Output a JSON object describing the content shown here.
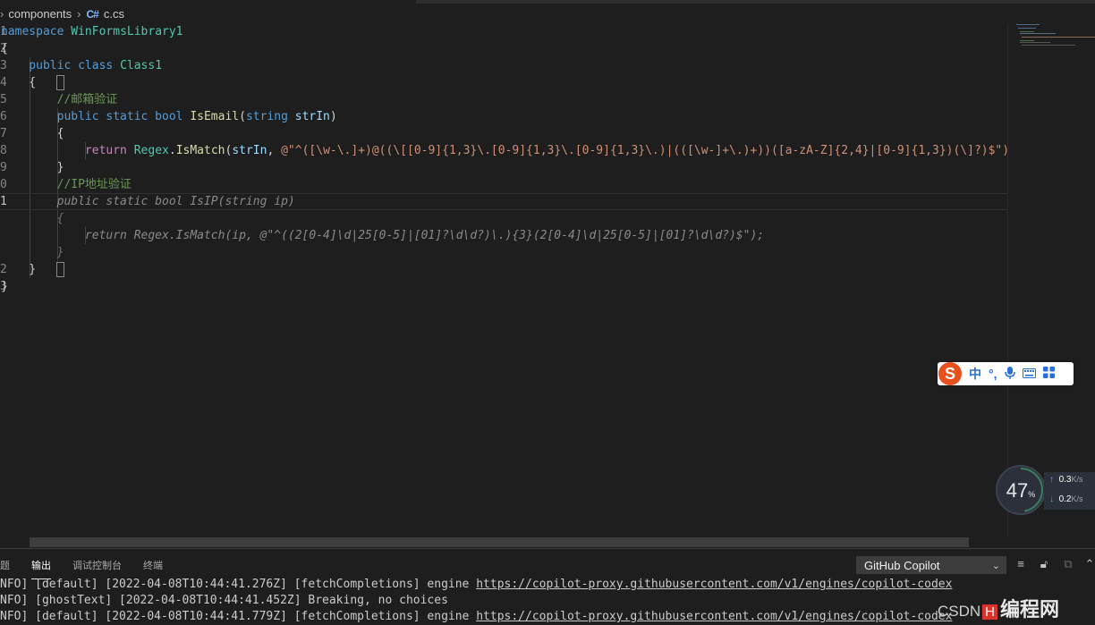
{
  "breadcrumb": {
    "folder": "components",
    "file_icon": "C#",
    "file": "c.cs"
  },
  "editor": {
    "lines": [
      {
        "num": "1",
        "tokens": [
          [
            "namespace ",
            "#569cd6"
          ],
          [
            "WinFormsLibrary1",
            "#4ec9b0"
          ]
        ]
      },
      {
        "num": "2",
        "tokens": [
          [
            "{",
            "#d4d4d4"
          ]
        ]
      },
      {
        "num": "3",
        "tokens": [
          [
            "    public ",
            "#569cd6"
          ],
          [
            "class ",
            "#569cd6"
          ],
          [
            "Class1",
            "#4ec9b0"
          ]
        ]
      },
      {
        "num": "4",
        "tokens": [
          [
            "    {",
            "#d4d4d4"
          ]
        ]
      },
      {
        "num": "5",
        "tokens": [
          [
            "        //邮箱验证",
            "#6a9955"
          ]
        ]
      },
      {
        "num": "6",
        "tokens": [
          [
            "        public static bool ",
            "#569cd6"
          ],
          [
            "IsEmail",
            "#dcdcaa"
          ],
          [
            "(",
            "#d4d4d4"
          ],
          [
            "string ",
            "#569cd6"
          ],
          [
            "strIn",
            "#9cdcfe"
          ],
          [
            ")",
            "#d4d4d4"
          ]
        ]
      },
      {
        "num": "7",
        "tokens": [
          [
            "        {",
            "#d4d4d4"
          ]
        ]
      },
      {
        "num": "8",
        "tokens": [
          [
            "            return ",
            "#c586c0"
          ],
          [
            "Regex",
            "#4ec9b0"
          ],
          [
            ".",
            "#d4d4d4"
          ],
          [
            "IsMatch",
            "#dcdcaa"
          ],
          [
            "(",
            "#d4d4d4"
          ],
          [
            "strIn",
            "#9cdcfe"
          ],
          [
            ", ",
            "#d4d4d4"
          ],
          [
            "@\"^([\\w-\\.]+)@((\\[[0-9]{1,3}\\.[0-9]{1,3}\\.[0-9]{1,3}\\.)|(([\\w-]+\\.)+))([a-zA-Z]{2,4}|[0-9]{1,3})(\\]?)$\");",
            "#ce9178"
          ]
        ]
      },
      {
        "num": "9",
        "tokens": [
          [
            "        }",
            "#d4d4d4"
          ]
        ]
      },
      {
        "num": "0",
        "tokens": [
          [
            "        //IP地址验证",
            "#6a9955"
          ]
        ]
      },
      {
        "num": "1",
        "current": true,
        "tokens": [
          [
            "        public static bool IsIP(string ip)",
            "#8a8a8a",
            "italic"
          ]
        ]
      },
      {
        "num": "",
        "tokens": [
          [
            "        {",
            "#6e6e6e",
            "italic"
          ]
        ]
      },
      {
        "num": "",
        "tokens": [
          [
            "            return Regex.IsMatch(ip, @\"^((2[0-4]\\d|25[0-5]|[01]?\\d\\d?)\\.){3}(2[0-4]\\d|25[0-5]|[01]?\\d\\d?)$\");",
            "#8a8a8a",
            "italic"
          ]
        ]
      },
      {
        "num": "",
        "tokens": [
          [
            "        }",
            "#6e6e6e",
            "italic"
          ]
        ]
      },
      {
        "num": "2",
        "tokens": [
          [
            "    }",
            "#d4d4d4"
          ]
        ]
      },
      {
        "num": "3",
        "tokens": [
          [
            "}",
            "#d4d4d4"
          ]
        ]
      }
    ]
  },
  "panel": {
    "tabs": [
      {
        "label": "题",
        "active": false
      },
      {
        "label": "输出",
        "active": true
      },
      {
        "label": "调试控制台",
        "active": false
      },
      {
        "label": "终端",
        "active": false
      }
    ],
    "channel": "GitHub Copilot",
    "log": [
      {
        "prefix": "NFO] [default] [2022-04-08T10:44:41.276Z] [fetchCompletions] engine ",
        "link": "https://copilot-proxy.githubusercontent.com/v1/engines/copilot-codex"
      },
      {
        "prefix": "NFO] [ghostText] [2022-04-08T10:44:41.452Z] Breaking, no choices",
        "link": ""
      },
      {
        "prefix": "NFO] [default] [2022-04-08T10:44:41.779Z] [fetchCompletions] engine ",
        "link": "https://copilot-proxy.githubusercontent.com/v1/engines/copilot-codex"
      }
    ]
  },
  "ime": {
    "logo": "S",
    "items": [
      "中",
      "°,",
      "mic-icon",
      "keyboard-icon",
      "grid-icon"
    ]
  },
  "speed": {
    "percent": "47",
    "percent_unit": "%",
    "up_value": "0.3",
    "up_unit": "K/s",
    "down_value": "0.2",
    "down_unit": "K/s"
  },
  "watermark": {
    "text": "CSDN",
    "logo": "H",
    "brand": "编程网"
  },
  "icons": {
    "clear_output": "lines-icon",
    "lock": "lock-icon",
    "copy": "copy-icon",
    "collapse": "chevron-up-icon"
  }
}
